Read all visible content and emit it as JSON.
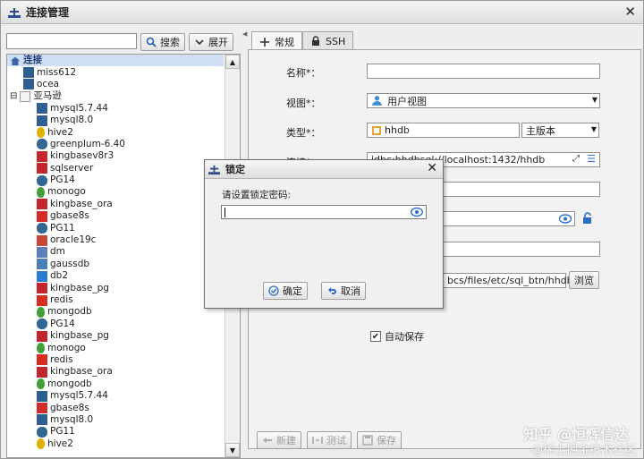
{
  "window": {
    "title": "连接管理",
    "close_glyph": "✕"
  },
  "search": {
    "value": "",
    "search_label": "搜索",
    "expand_label": "展开"
  },
  "tree": {
    "root": "连接",
    "items": [
      {
        "label": "miss612",
        "icon": "mysql",
        "indent": 1
      },
      {
        "label": "ocea",
        "icon": "mysql",
        "indent": 1
      },
      {
        "label": "亚马逊",
        "icon": "folder",
        "indent": 0,
        "collapse": true
      },
      {
        "label": "mysql5.7.44",
        "icon": "mysql",
        "indent": 2
      },
      {
        "label": "mysql8.0",
        "icon": "mysql",
        "indent": 2
      },
      {
        "label": "hive2",
        "icon": "hive",
        "indent": 2
      },
      {
        "label": "greenplum-6.40",
        "icon": "postgres",
        "indent": 2
      },
      {
        "label": "kingbasev8r3",
        "icon": "kingbase",
        "indent": 2
      },
      {
        "label": "sqlserver",
        "icon": "sqlserver",
        "indent": 2
      },
      {
        "label": "PG14",
        "icon": "postgres",
        "indent": 2
      },
      {
        "label": "monogo",
        "icon": "mongo",
        "indent": 2
      },
      {
        "label": "kingbase_ora",
        "icon": "kingbase",
        "indent": 2
      },
      {
        "label": "gbase8s",
        "icon": "gbase",
        "indent": 2
      },
      {
        "label": "PG11",
        "icon": "postgres",
        "indent": 2
      },
      {
        "label": "oracle19c",
        "icon": "oracle",
        "indent": 2
      },
      {
        "label": "dm",
        "icon": "dm",
        "indent": 2
      },
      {
        "label": "gaussdb",
        "icon": "gauss",
        "indent": 2
      },
      {
        "label": "db2",
        "icon": "db2",
        "indent": 2
      },
      {
        "label": "kingbase_pg",
        "icon": "kingbase",
        "indent": 2
      },
      {
        "label": "redis",
        "icon": "redis",
        "indent": 2
      },
      {
        "label": "mongodb",
        "icon": "mongo",
        "indent": 2
      },
      {
        "label": "PG14",
        "icon": "postgres",
        "indent": 2
      },
      {
        "label": "kingbase_pg",
        "icon": "kingbase",
        "indent": 2
      },
      {
        "label": "monogo",
        "icon": "mongo",
        "indent": 2
      },
      {
        "label": "redis",
        "icon": "redis",
        "indent": 2
      },
      {
        "label": "kingbase_ora",
        "icon": "kingbase",
        "indent": 2
      },
      {
        "label": "mongodb",
        "icon": "mongo",
        "indent": 2
      },
      {
        "label": "mysql5.7.44",
        "icon": "mysql",
        "indent": 2
      },
      {
        "label": "gbase8s",
        "icon": "gbase",
        "indent": 2
      },
      {
        "label": "mysql8.0",
        "icon": "mysql",
        "indent": 2
      },
      {
        "label": "PG11",
        "icon": "postgres",
        "indent": 2
      },
      {
        "label": "hive2",
        "icon": "hive",
        "indent": 2
      }
    ]
  },
  "tabs": [
    {
      "label": "常规",
      "icon": "plus-icon"
    },
    {
      "label": "SSH",
      "icon": "lock-icon"
    }
  ],
  "form": {
    "name_label": "名称*：",
    "name_value": "",
    "view_label": "视图*：",
    "view_value": "用户视图",
    "type_label": "类型*：",
    "type_value": "hhdb",
    "version_value": "主版本",
    "conn_label": "连接*：",
    "conn_value": "jdbc:hhdbsql://localhost:1432/hhdb",
    "path_value": "bcs/files/etc/sql_btn/hhdb",
    "browse_label": "浏览",
    "autosave_label": "自动保存",
    "autosave_checked": true
  },
  "bottom_buttons": {
    "new": "新建",
    "test": "测试",
    "save": "保存"
  },
  "dialog": {
    "title": "锁定",
    "prompt": "请设置锁定密码:",
    "password_value": "",
    "ok_label": "确定",
    "cancel_label": "取消"
  },
  "watermark": {
    "line1": "知乎 @恒辉信达",
    "line2": "@稀土掘金技术社区"
  },
  "colors": {
    "accent": "#1f5fbf",
    "root_highlight": "#cfdef2",
    "eye": "#2a6ec7"
  }
}
